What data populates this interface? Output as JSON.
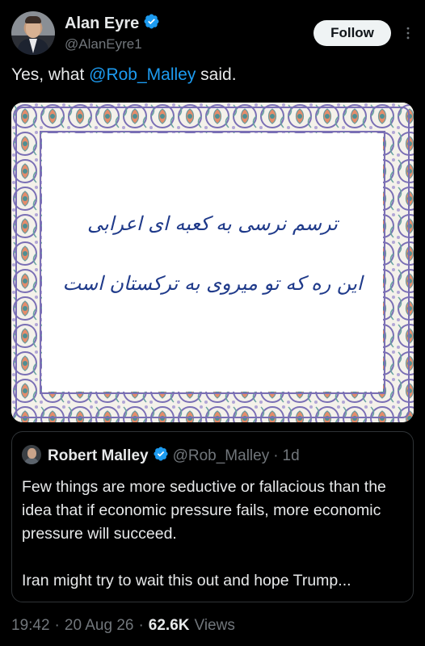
{
  "tweet": {
    "author_name": "Alan Eyre",
    "author_handle": "@AlanEyre1",
    "follow_label": "Follow",
    "text_prefix": "Yes, what ",
    "mention": "@Rob_Malley",
    "text_suffix": " said.",
    "image_poem_line1": "ترسم نرسی به کعبه ای اعرابی",
    "image_poem_line2": "این ره که تو میروی به ترکستان است",
    "time": "19:42",
    "date": "20 Aug 26",
    "views_count": "62.6K",
    "views_label": "Views"
  },
  "quoted": {
    "author_name": "Robert Malley",
    "author_handle": "@Rob_Malley",
    "separator": "·",
    "age": "1d",
    "paragraph1": "Few things are more seductive or fallacious than the idea that if economic pressure fails, more economic pressure will succeed.",
    "paragraph2": "Iran might try to wait this out and hope Trump..."
  },
  "colors": {
    "background": "#000000",
    "text": "#e7e9ea",
    "muted": "#71767b",
    "accent": "#1d9bf0",
    "verified": "#1d9bf0"
  },
  "icons": {
    "verified": "verified-badge-icon",
    "more": "more-dots-icon"
  }
}
